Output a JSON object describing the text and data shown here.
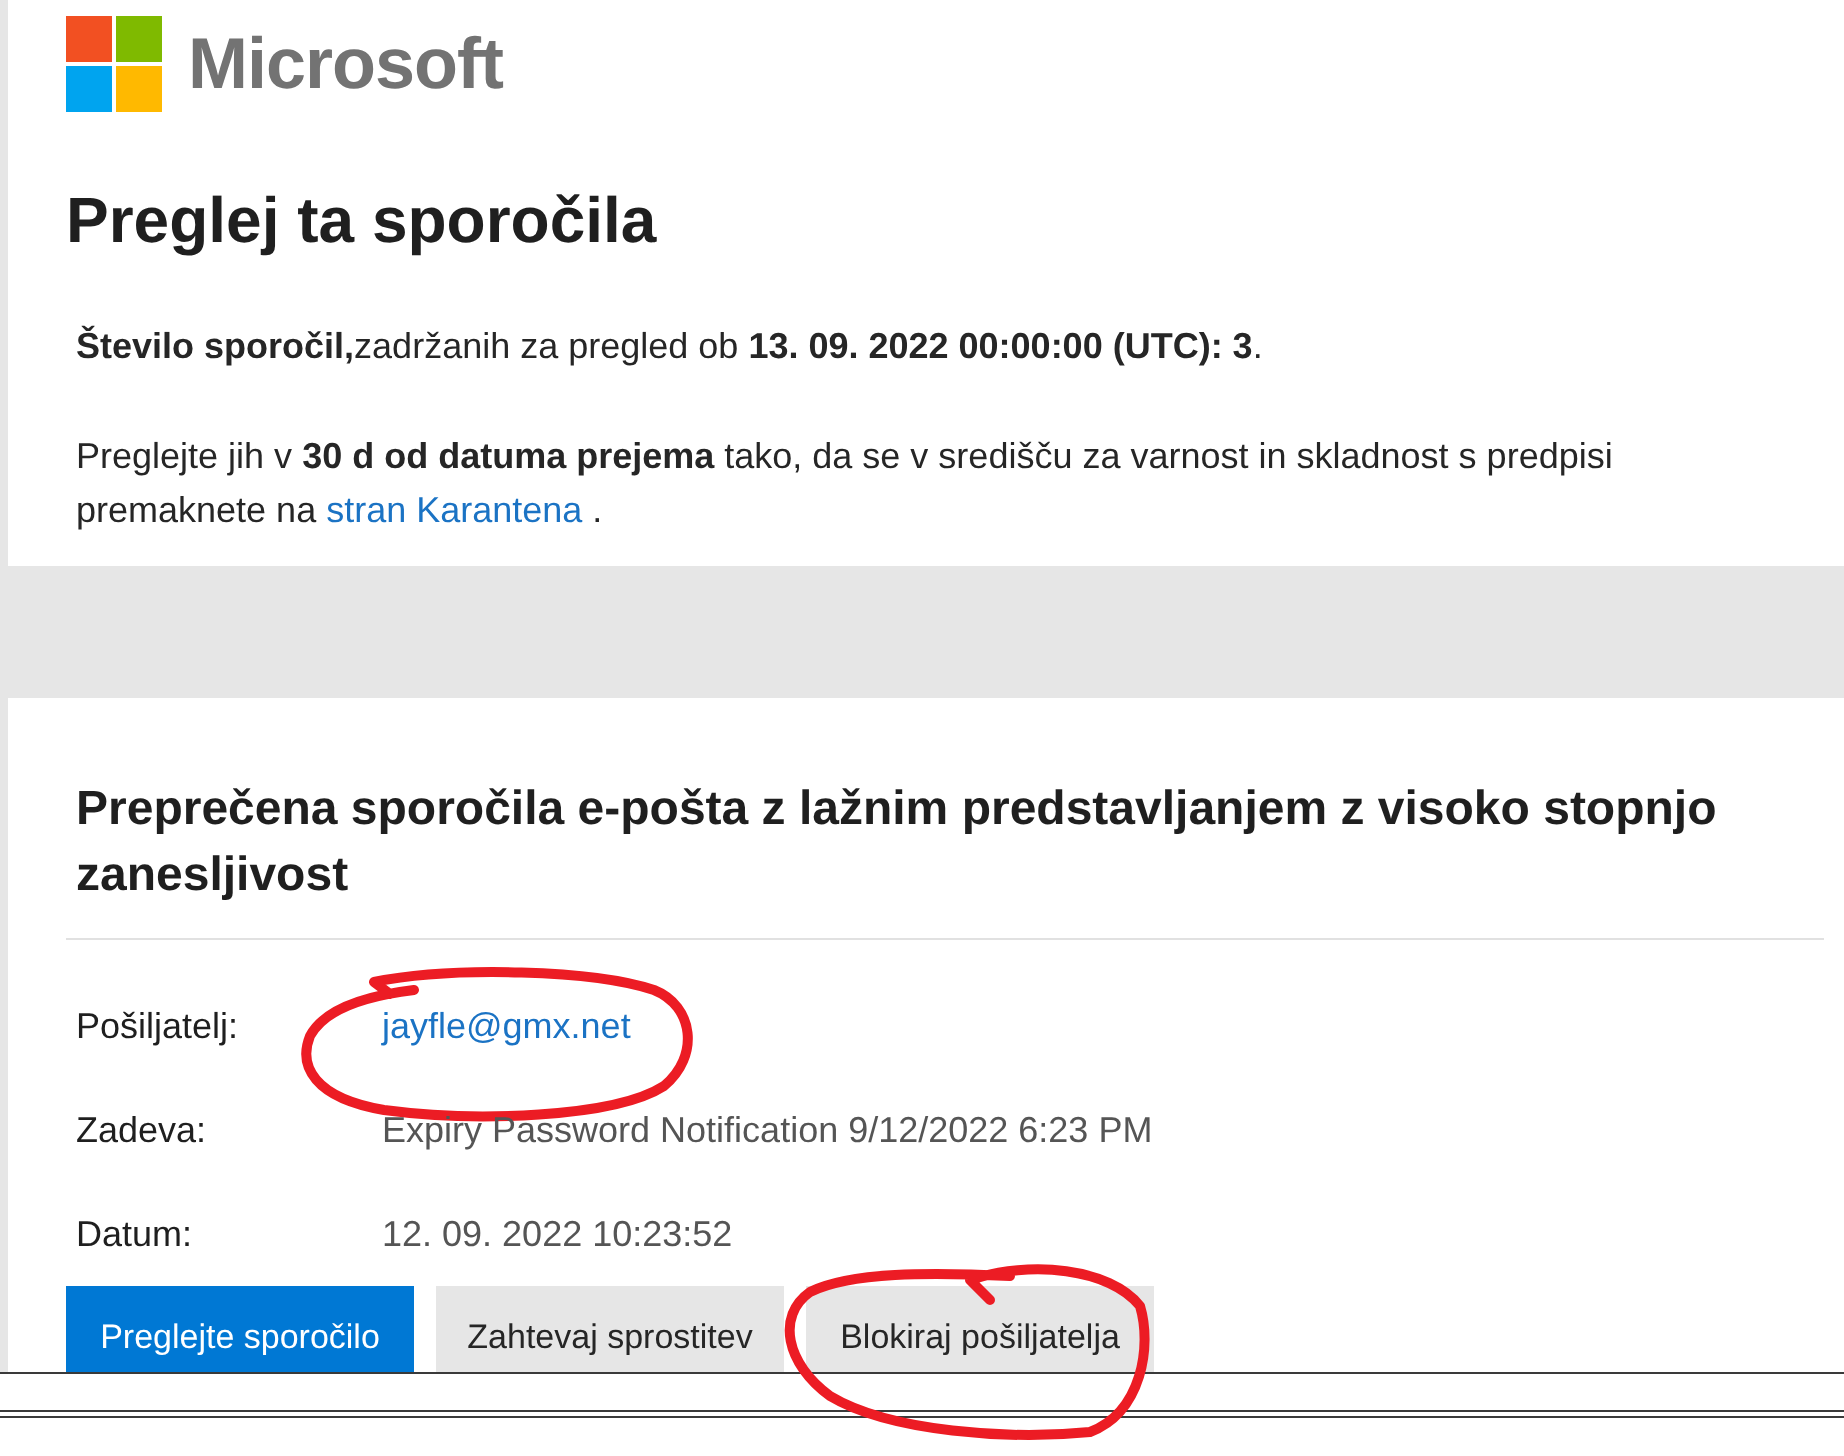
{
  "logo": {
    "name": "Microsoft"
  },
  "title": "Preglej ta sporočila",
  "summary": "**Število sporočil,**zadržanih za pregled ob **13. 09. 2022 00:00:00 (UTC): 3**.",
  "instructions": {
    "text": "Preglejte jih v **30 d od datuma prejema** tako, da se v središču za varnost in skladnost s predpisi premaknete na",
    "link": "stran Karantena",
    "end": "."
  },
  "blocked_messages": {
    "heading": "Preprečena sporočila e-pošta z lažnim predstavljanjem z visoko stopnjo zanesljivost",
    "fields": [
      {
        "label": "Pošiljatelj:",
        "value": "jayfle@gmx.net",
        "kind": "link",
        "circled": true
      },
      {
        "label": "Zadeva:",
        "value": "Expiry Password Notification 9/12/2022 6:23 PM",
        "kind": "text",
        "circled": false
      },
      {
        "label": "Datum:",
        "value": "12. 09. 2022 10:23:52",
        "kind": "text",
        "circled": false
      }
    ],
    "buttons": [
      {
        "label": "Preglejte sporočilo",
        "kind": "primary",
        "circled": false
      },
      {
        "label": "Zahtevaj sprostitev",
        "kind": "secondary",
        "circled": false
      },
      {
        "label": "Blokiraj pošiljatelja",
        "kind": "secondary",
        "circled": true
      }
    ]
  }
}
